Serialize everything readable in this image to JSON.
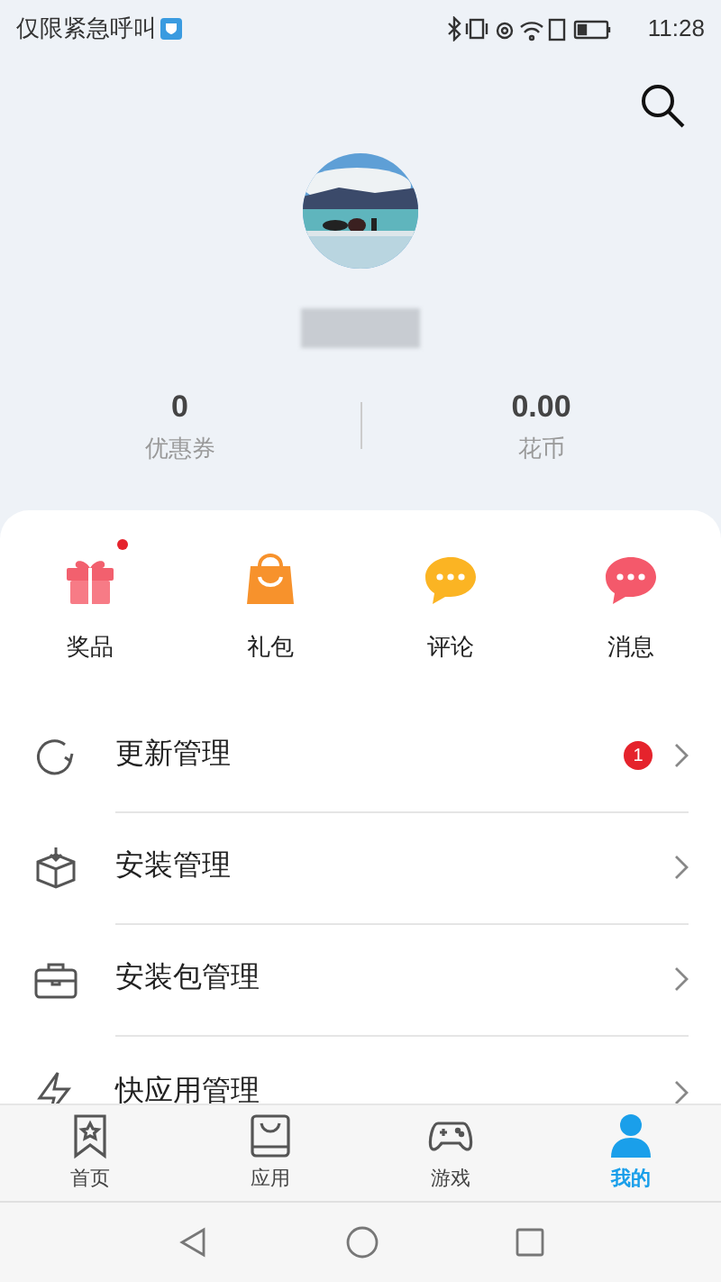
{
  "status_bar": {
    "carrier": "仅限紧急呼叫",
    "time": "11:28"
  },
  "profile": {
    "stats": [
      {
        "value": "0",
        "label": "优惠券"
      },
      {
        "value": "0.00",
        "label": "花币"
      }
    ]
  },
  "shortcuts": [
    {
      "kind": "gift",
      "label": "奖品",
      "dot": true
    },
    {
      "kind": "bag",
      "label": "礼包",
      "dot": false
    },
    {
      "kind": "comment",
      "label": "评论",
      "dot": false
    },
    {
      "kind": "message",
      "label": "消息",
      "dot": false
    }
  ],
  "menu": [
    {
      "kind": "update",
      "label": "更新管理",
      "badge": "1"
    },
    {
      "kind": "install",
      "label": "安装管理"
    },
    {
      "kind": "package",
      "label": "安装包管理"
    },
    {
      "kind": "quickapp",
      "label": "快应用管理"
    }
  ],
  "tabs": [
    {
      "kind": "home",
      "label": "首页",
      "selected": false
    },
    {
      "kind": "apps",
      "label": "应用",
      "selected": false
    },
    {
      "kind": "games",
      "label": "游戏",
      "selected": false
    },
    {
      "kind": "me",
      "label": "我的",
      "selected": true
    }
  ]
}
